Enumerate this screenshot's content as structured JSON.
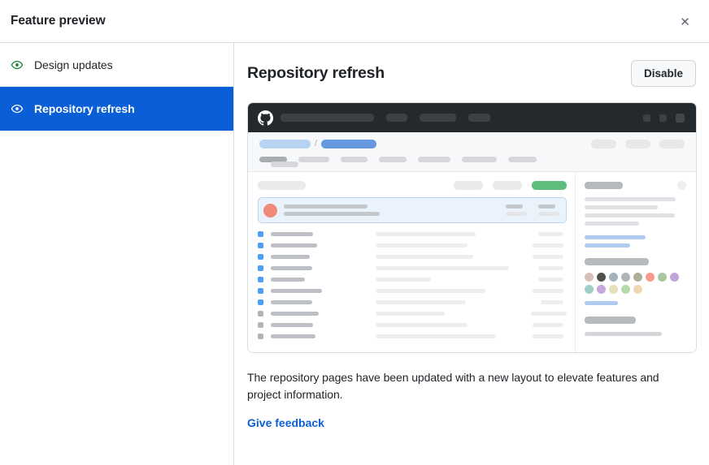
{
  "dialog": {
    "title": "Feature preview",
    "close_icon": "close-icon"
  },
  "sidebar": {
    "items": [
      {
        "label": "Design updates",
        "icon": "eye-icon",
        "selected": false
      },
      {
        "label": "Repository refresh",
        "icon": "eye-icon",
        "selected": true
      }
    ]
  },
  "main": {
    "heading": "Repository refresh",
    "toggle_button": "Disable",
    "description": "The repository pages have been updated with a new layout to elevate features and project information.",
    "feedback_link": "Give feedback"
  },
  "preview": {
    "logo_icon": "github-logo-icon",
    "breadcrumb_separator": "/",
    "topbar_bars": [
      115,
      26,
      45,
      27
    ],
    "topbar_squares": 3,
    "header_pills": [
      31,
      31,
      31
    ],
    "tabs": [
      34,
      38,
      33,
      34,
      40,
      43,
      35
    ],
    "active_tab_index": 0,
    "active_tab_color": "#f26522",
    "code_button_color": "#5fbd7e",
    "highlight_row_bg": "#eaf2fc",
    "highlight_row_border": "#bcd6f3",
    "avatar_color": "#f08a78",
    "folder_icon_color": "#4d9ef6",
    "file_icon_color": "#b0b3b7",
    "file_rows": [
      {
        "type": "folder",
        "name_w": 52,
        "desc_w": 123,
        "time_w": 31,
        "time_right": 4
      },
      {
        "type": "folder",
        "name_w": 57,
        "desc_w": 113,
        "time_w": 38,
        "time_right": 4
      },
      {
        "type": "folder",
        "name_w": 48,
        "desc_w": 120,
        "time_w": 38,
        "time_right": 4
      },
      {
        "type": "folder",
        "name_w": 51,
        "desc_w": 164,
        "time_w": 31,
        "time_right": 4
      },
      {
        "type": "folder",
        "name_w": 42,
        "desc_w": 68,
        "time_w": 31,
        "time_right": 4
      },
      {
        "type": "folder",
        "name_w": 63,
        "desc_w": 135,
        "time_w": 38,
        "time_right": 4
      },
      {
        "type": "folder",
        "name_w": 51,
        "desc_w": 111,
        "time_w": 28,
        "time_right": 4
      },
      {
        "type": "file",
        "name_w": 59,
        "desc_w": 85,
        "time_w": 44,
        "time_right": 0
      },
      {
        "type": "file",
        "name_w": 52,
        "desc_w": 113,
        "time_w": 38,
        "time_right": 4
      },
      {
        "type": "file",
        "name_w": 55,
        "desc_w": 148,
        "time_w": 38,
        "time_right": 4
      }
    ],
    "sidebar_lines": [
      112,
      90,
      111,
      67
    ],
    "sidebar_links": [
      75,
      56
    ],
    "contributor_colors": [
      "#d9c0b8",
      "#4f4f4d",
      "#a3b3bb",
      "#b0b4b7",
      "#adae9b",
      "#f69b89",
      "#a8c7a0",
      "#c1a4dc",
      "#9fcfc6",
      "#c4a8dd",
      "#e4e0b8",
      "#b6dbab",
      "#f0d7b4"
    ],
    "sidebar_tail": 95
  }
}
